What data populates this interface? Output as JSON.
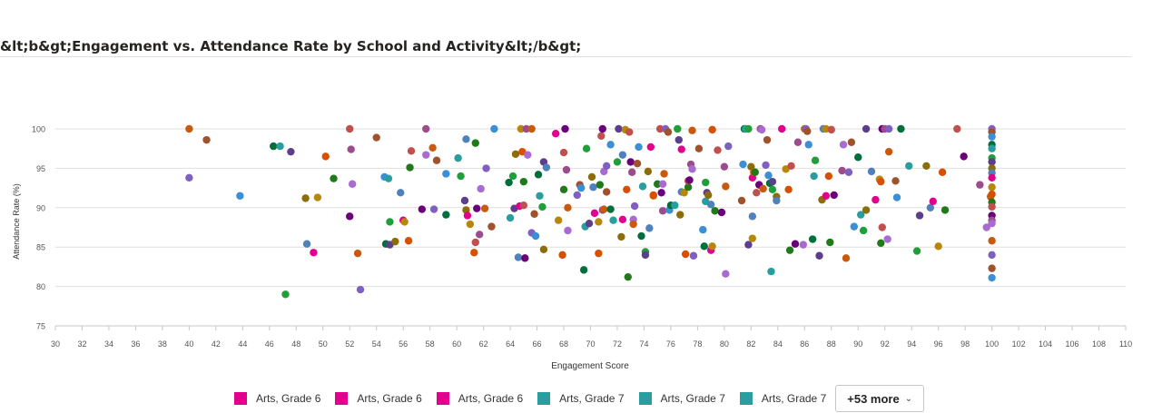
{
  "chart_data": {
    "type": "scatter",
    "title": "&lt;b&gt;Engagement vs. Attendance Rate by School and Activity&lt;/b&gt;",
    "xlabel": "Engagement Score",
    "ylabel": "Attendance Rate (%)",
    "xlim": [
      30,
      110
    ],
    "ylim": [
      75,
      100
    ],
    "xticks": [
      30,
      32,
      34,
      36,
      38,
      40,
      42,
      44,
      46,
      48,
      50,
      52,
      54,
      56,
      58,
      60,
      62,
      64,
      66,
      68,
      70,
      72,
      74,
      76,
      78,
      80,
      82,
      84,
      86,
      88,
      90,
      92,
      94,
      96,
      98,
      100,
      102,
      104,
      106,
      108,
      110
    ],
    "yticks": [
      75,
      80,
      85,
      90,
      95,
      100
    ],
    "grid": "horizontal",
    "legend_position": "bottom",
    "legend": {
      "items": [
        {
          "label": "Arts, Grade 6",
          "color": "#e3008c"
        },
        {
          "label": "Arts, Grade 6",
          "color": "#e3008c"
        },
        {
          "label": "Arts, Grade 6",
          "color": "#e3008c"
        },
        {
          "label": "Arts, Grade 7",
          "color": "#2a9d9f"
        },
        {
          "label": "Arts, Grade 7",
          "color": "#2a9d9f"
        },
        {
          "label": "Arts, Grade 7",
          "color": "#2a9d9f"
        }
      ],
      "more_label": "+53 more"
    },
    "palette": [
      "#6b007b",
      "#e3008c",
      "#2a9d9f",
      "#c8590f",
      "#217a1a",
      "#8b6d09",
      "#3a8fd7",
      "#9a4c8c",
      "#b8860b",
      "#1f9e3a",
      "#7f5fbf",
      "#c0504d",
      "#4f81bd",
      "#006f3c",
      "#a86bd1",
      "#d94f00",
      "#5b3f8c",
      "#a0522d"
    ],
    "points": [
      [
        40,
        100
      ],
      [
        40,
        93.8
      ],
      [
        41.3,
        98.6
      ],
      [
        43.8,
        91.5
      ],
      [
        46.3,
        97.8
      ],
      [
        46.8,
        97.8
      ],
      [
        47.2,
        79
      ],
      [
        47.6,
        97.1
      ],
      [
        48.7,
        91.2
      ],
      [
        48.8,
        85.4
      ],
      [
        49.3,
        84.3
      ],
      [
        49.6,
        91.3
      ],
      [
        50.2,
        96.5
      ],
      [
        50.8,
        93.7
      ],
      [
        52,
        100
      ],
      [
        52,
        88.9
      ],
      [
        52.1,
        97.4
      ],
      [
        52.2,
        93
      ],
      [
        52.6,
        84.2
      ],
      [
        52.8,
        79.6
      ],
      [
        54,
        98.9
      ],
      [
        54.6,
        93.9
      ],
      [
        54.7,
        85.4
      ],
      [
        54.9,
        93.7
      ],
      [
        55,
        88.2
      ],
      [
        55,
        85.3
      ],
      [
        55.4,
        85.7
      ],
      [
        55.8,
        91.9
      ],
      [
        56,
        88.4
      ],
      [
        56.1,
        88.2
      ],
      [
        56.4,
        85.8
      ],
      [
        56.5,
        95.1
      ],
      [
        56.6,
        97.2
      ],
      [
        57.4,
        89.8
      ],
      [
        57.7,
        100
      ],
      [
        57.7,
        96.7
      ],
      [
        58.2,
        97.6
      ],
      [
        58.3,
        89.8
      ],
      [
        58.5,
        96
      ],
      [
        59.2,
        94.3
      ],
      [
        59.2,
        89.1
      ],
      [
        60.1,
        96.3
      ],
      [
        60.3,
        94
      ],
      [
        60.6,
        90.9
      ],
      [
        60.7,
        89.7
      ],
      [
        60.7,
        98.7
      ],
      [
        60.8,
        89
      ],
      [
        61,
        87.9
      ],
      [
        61.3,
        84.3
      ],
      [
        61.4,
        98.2
      ],
      [
        61.4,
        85.6
      ],
      [
        61.5,
        89.9
      ],
      [
        61.7,
        86.6
      ],
      [
        61.8,
        92.4
      ],
      [
        62.1,
        89.9
      ],
      [
        62.2,
        95
      ],
      [
        62.6,
        87.6
      ],
      [
        62.8,
        100
      ],
      [
        63.9,
        93.2
      ],
      [
        64,
        88.7
      ],
      [
        64.2,
        94
      ],
      [
        64.3,
        89.9
      ],
      [
        64.4,
        96.8
      ],
      [
        64.6,
        83.7
      ],
      [
        64.7,
        90.2
      ],
      [
        64.8,
        100
      ],
      [
        64.9,
        97.1
      ],
      [
        65,
        93.3
      ],
      [
        65,
        90.3
      ],
      [
        65.1,
        83.6
      ],
      [
        65.2,
        100
      ],
      [
        65.3,
        96.7
      ],
      [
        65.6,
        100
      ],
      [
        65.6,
        86.8
      ],
      [
        65.8,
        89.2
      ],
      [
        65.9,
        86.4
      ],
      [
        66.1,
        94.2
      ],
      [
        66.2,
        91.5
      ],
      [
        66.4,
        90.1
      ],
      [
        66.5,
        95.8
      ],
      [
        66.5,
        84.7
      ],
      [
        66.7,
        95.1
      ],
      [
        67.4,
        99.4
      ],
      [
        67.6,
        88.4
      ],
      [
        67.9,
        84
      ],
      [
        68,
        92.3
      ],
      [
        68,
        97
      ],
      [
        68.1,
        100
      ],
      [
        68.2,
        94.8
      ],
      [
        68.3,
        87.1
      ],
      [
        68.3,
        90
      ],
      [
        69,
        91.6
      ],
      [
        69.2,
        92.9
      ],
      [
        69.3,
        92.5
      ],
      [
        69.5,
        82.1
      ],
      [
        69.6,
        87.6
      ],
      [
        69.7,
        97.5
      ],
      [
        69.9,
        88
      ],
      [
        70.1,
        93.9
      ],
      [
        70.2,
        92.6
      ],
      [
        70.3,
        89.3
      ],
      [
        70.6,
        88.2
      ],
      [
        70.6,
        84.2
      ],
      [
        70.7,
        92.9
      ],
      [
        70.8,
        99.1
      ],
      [
        70.9,
        100
      ],
      [
        70.9,
        89.7
      ],
      [
        71,
        94.6
      ],
      [
        71,
        89.8
      ],
      [
        71.2,
        95.3
      ],
      [
        71.2,
        92
      ],
      [
        71.5,
        98
      ],
      [
        71.5,
        89.8
      ],
      [
        71.7,
        88.4
      ],
      [
        72,
        95.8
      ],
      [
        72.1,
        100
      ],
      [
        72.3,
        86.3
      ],
      [
        72.4,
        96.7
      ],
      [
        72.4,
        88.5
      ],
      [
        72.6,
        99.9
      ],
      [
        72.7,
        92.3
      ],
      [
        72.8,
        81.2
      ],
      [
        72.9,
        99.6
      ],
      [
        73,
        95.8
      ],
      [
        73.1,
        94.5
      ],
      [
        73.2,
        88.5
      ],
      [
        73.2,
        87.9
      ],
      [
        73.3,
        90.2
      ],
      [
        73.5,
        95.6
      ],
      [
        73.6,
        97.7
      ],
      [
        73.8,
        86.4
      ],
      [
        73.9,
        92.7
      ],
      [
        74.1,
        84.4
      ],
      [
        74.1,
        84
      ],
      [
        74.3,
        94.6
      ],
      [
        74.4,
        87.4
      ],
      [
        74.5,
        97.7
      ],
      [
        74.7,
        91.5
      ],
      [
        74.7,
        91.6
      ],
      [
        75,
        93
      ],
      [
        75.2,
        100
      ],
      [
        75.3,
        91.9
      ],
      [
        75.4,
        89.6
      ],
      [
        75.4,
        93
      ],
      [
        75.5,
        94.3
      ],
      [
        75.6,
        100
      ],
      [
        75.8,
        99.6
      ],
      [
        75.9,
        89.7
      ],
      [
        76,
        90.3
      ],
      [
        76.3,
        90.3
      ],
      [
        76.5,
        100
      ],
      [
        76.6,
        98.6
      ],
      [
        76.7,
        89.1
      ],
      [
        76.8,
        92
      ],
      [
        76.8,
        97.4
      ],
      [
        77,
        91.9
      ],
      [
        77.1,
        84.1
      ],
      [
        77.3,
        92.6
      ],
      [
        77.3,
        93.4
      ],
      [
        77.4,
        93.5
      ],
      [
        77.5,
        95.5
      ],
      [
        77.6,
        94.9
      ],
      [
        77.6,
        99.8
      ],
      [
        77.7,
        83.9
      ],
      [
        78.1,
        97.5
      ],
      [
        78.4,
        87.2
      ],
      [
        78.5,
        85.1
      ],
      [
        78.6,
        90.8
      ],
      [
        78.6,
        93.2
      ],
      [
        78.7,
        91.9
      ],
      [
        78.8,
        91.6
      ],
      [
        79,
        90.4
      ],
      [
        79,
        84.6
      ],
      [
        79.1,
        85.1
      ],
      [
        79.1,
        99.9
      ],
      [
        79.3,
        89.6
      ],
      [
        79.5,
        97.3
      ],
      [
        79.8,
        89.4
      ],
      [
        80,
        95.2
      ],
      [
        80.1,
        81.6
      ],
      [
        80.1,
        92.7
      ],
      [
        80.3,
        97.8
      ],
      [
        81.3,
        90.9
      ],
      [
        81.4,
        95.5
      ],
      [
        81.5,
        100
      ],
      [
        81.6,
        100
      ],
      [
        81.8,
        100
      ],
      [
        81.8,
        85.3
      ],
      [
        82,
        95.2
      ],
      [
        82.1,
        88.9
      ],
      [
        82.1,
        93.8
      ],
      [
        82.1,
        86.1
      ],
      [
        82.2,
        94.5
      ],
      [
        82.3,
        94.5
      ],
      [
        82.4,
        91.9
      ],
      [
        82.6,
        92.9
      ],
      [
        82.7,
        100
      ],
      [
        82.8,
        99.9
      ],
      [
        82.9,
        92.4
      ],
      [
        83.1,
        95.4
      ],
      [
        83.2,
        98.6
      ],
      [
        83.3,
        94.1
      ],
      [
        83.4,
        93.1
      ],
      [
        83.5,
        81.9
      ],
      [
        83.6,
        92.3
      ],
      [
        83.6,
        93.3
      ],
      [
        83.9,
        91.4
      ],
      [
        83.9,
        90.9
      ],
      [
        84.3,
        100
      ],
      [
        84.6,
        94.9
      ],
      [
        84.8,
        92.3
      ],
      [
        84.9,
        84.6
      ],
      [
        85,
        95.3
      ],
      [
        85.3,
        85.4
      ],
      [
        85.5,
        98.3
      ],
      [
        85.9,
        85.3
      ],
      [
        86,
        100
      ],
      [
        86.1,
        100
      ],
      [
        86.2,
        99.7
      ],
      [
        86.3,
        98
      ],
      [
        86.6,
        86
      ],
      [
        86.7,
        94
      ],
      [
        86.8,
        96
      ],
      [
        87.1,
        83.9
      ],
      [
        87.3,
        91
      ],
      [
        87.4,
        100
      ],
      [
        87.6,
        91.5
      ],
      [
        87.6,
        100
      ],
      [
        87.8,
        94
      ],
      [
        87.9,
        85.6
      ],
      [
        88,
        99.9
      ],
      [
        88.2,
        91.6
      ],
      [
        88.8,
        94.7
      ],
      [
        88.9,
        98
      ],
      [
        89.1,
        83.6
      ],
      [
        89.3,
        94.5
      ],
      [
        89.5,
        98.3
      ],
      [
        89.7,
        87.6
      ],
      [
        90,
        96.4
      ],
      [
        90.2,
        89.1
      ],
      [
        90.4,
        87.1
      ],
      [
        90.6,
        100
      ],
      [
        90.6,
        89.7
      ],
      [
        91,
        94.6
      ],
      [
        91.3,
        91
      ],
      [
        91.6,
        93.6
      ],
      [
        91.7,
        93.3
      ],
      [
        91.7,
        85.5
      ],
      [
        91.8,
        87.5
      ],
      [
        91.8,
        100
      ],
      [
        92,
        100
      ],
      [
        92.2,
        86
      ],
      [
        92.3,
        97.1
      ],
      [
        92.3,
        100
      ],
      [
        92.8,
        93.4
      ],
      [
        92.9,
        91.3
      ],
      [
        93.2,
        100
      ],
      [
        93.8,
        95.3
      ],
      [
        94.4,
        84.5
      ],
      [
        94.6,
        89
      ],
      [
        95.1,
        95.3
      ],
      [
        95.4,
        90
      ],
      [
        95.6,
        90.8
      ],
      [
        96,
        85.1
      ],
      [
        96.3,
        94.5
      ],
      [
        96.5,
        89.7
      ],
      [
        97.4,
        100
      ],
      [
        97.9,
        96.5
      ],
      [
        99.1,
        92.9
      ],
      [
        99.6,
        87.5
      ],
      [
        99.9,
        91.4
      ],
      [
        100,
        100
      ],
      [
        100,
        99.6
      ],
      [
        100,
        99
      ],
      [
        100,
        98
      ],
      [
        100,
        97.5
      ],
      [
        100,
        96.3
      ],
      [
        100,
        95.8
      ],
      [
        100,
        95
      ],
      [
        100,
        94.4
      ],
      [
        100,
        93.8
      ],
      [
        100,
        92.6
      ],
      [
        100,
        91.7
      ],
      [
        100,
        90.7
      ],
      [
        100,
        90.1
      ],
      [
        100,
        89
      ],
      [
        100,
        88.4
      ],
      [
        100,
        88
      ],
      [
        100,
        85.8
      ],
      [
        100,
        84
      ],
      [
        100,
        82.3
      ],
      [
        100,
        81.1
      ]
    ]
  }
}
